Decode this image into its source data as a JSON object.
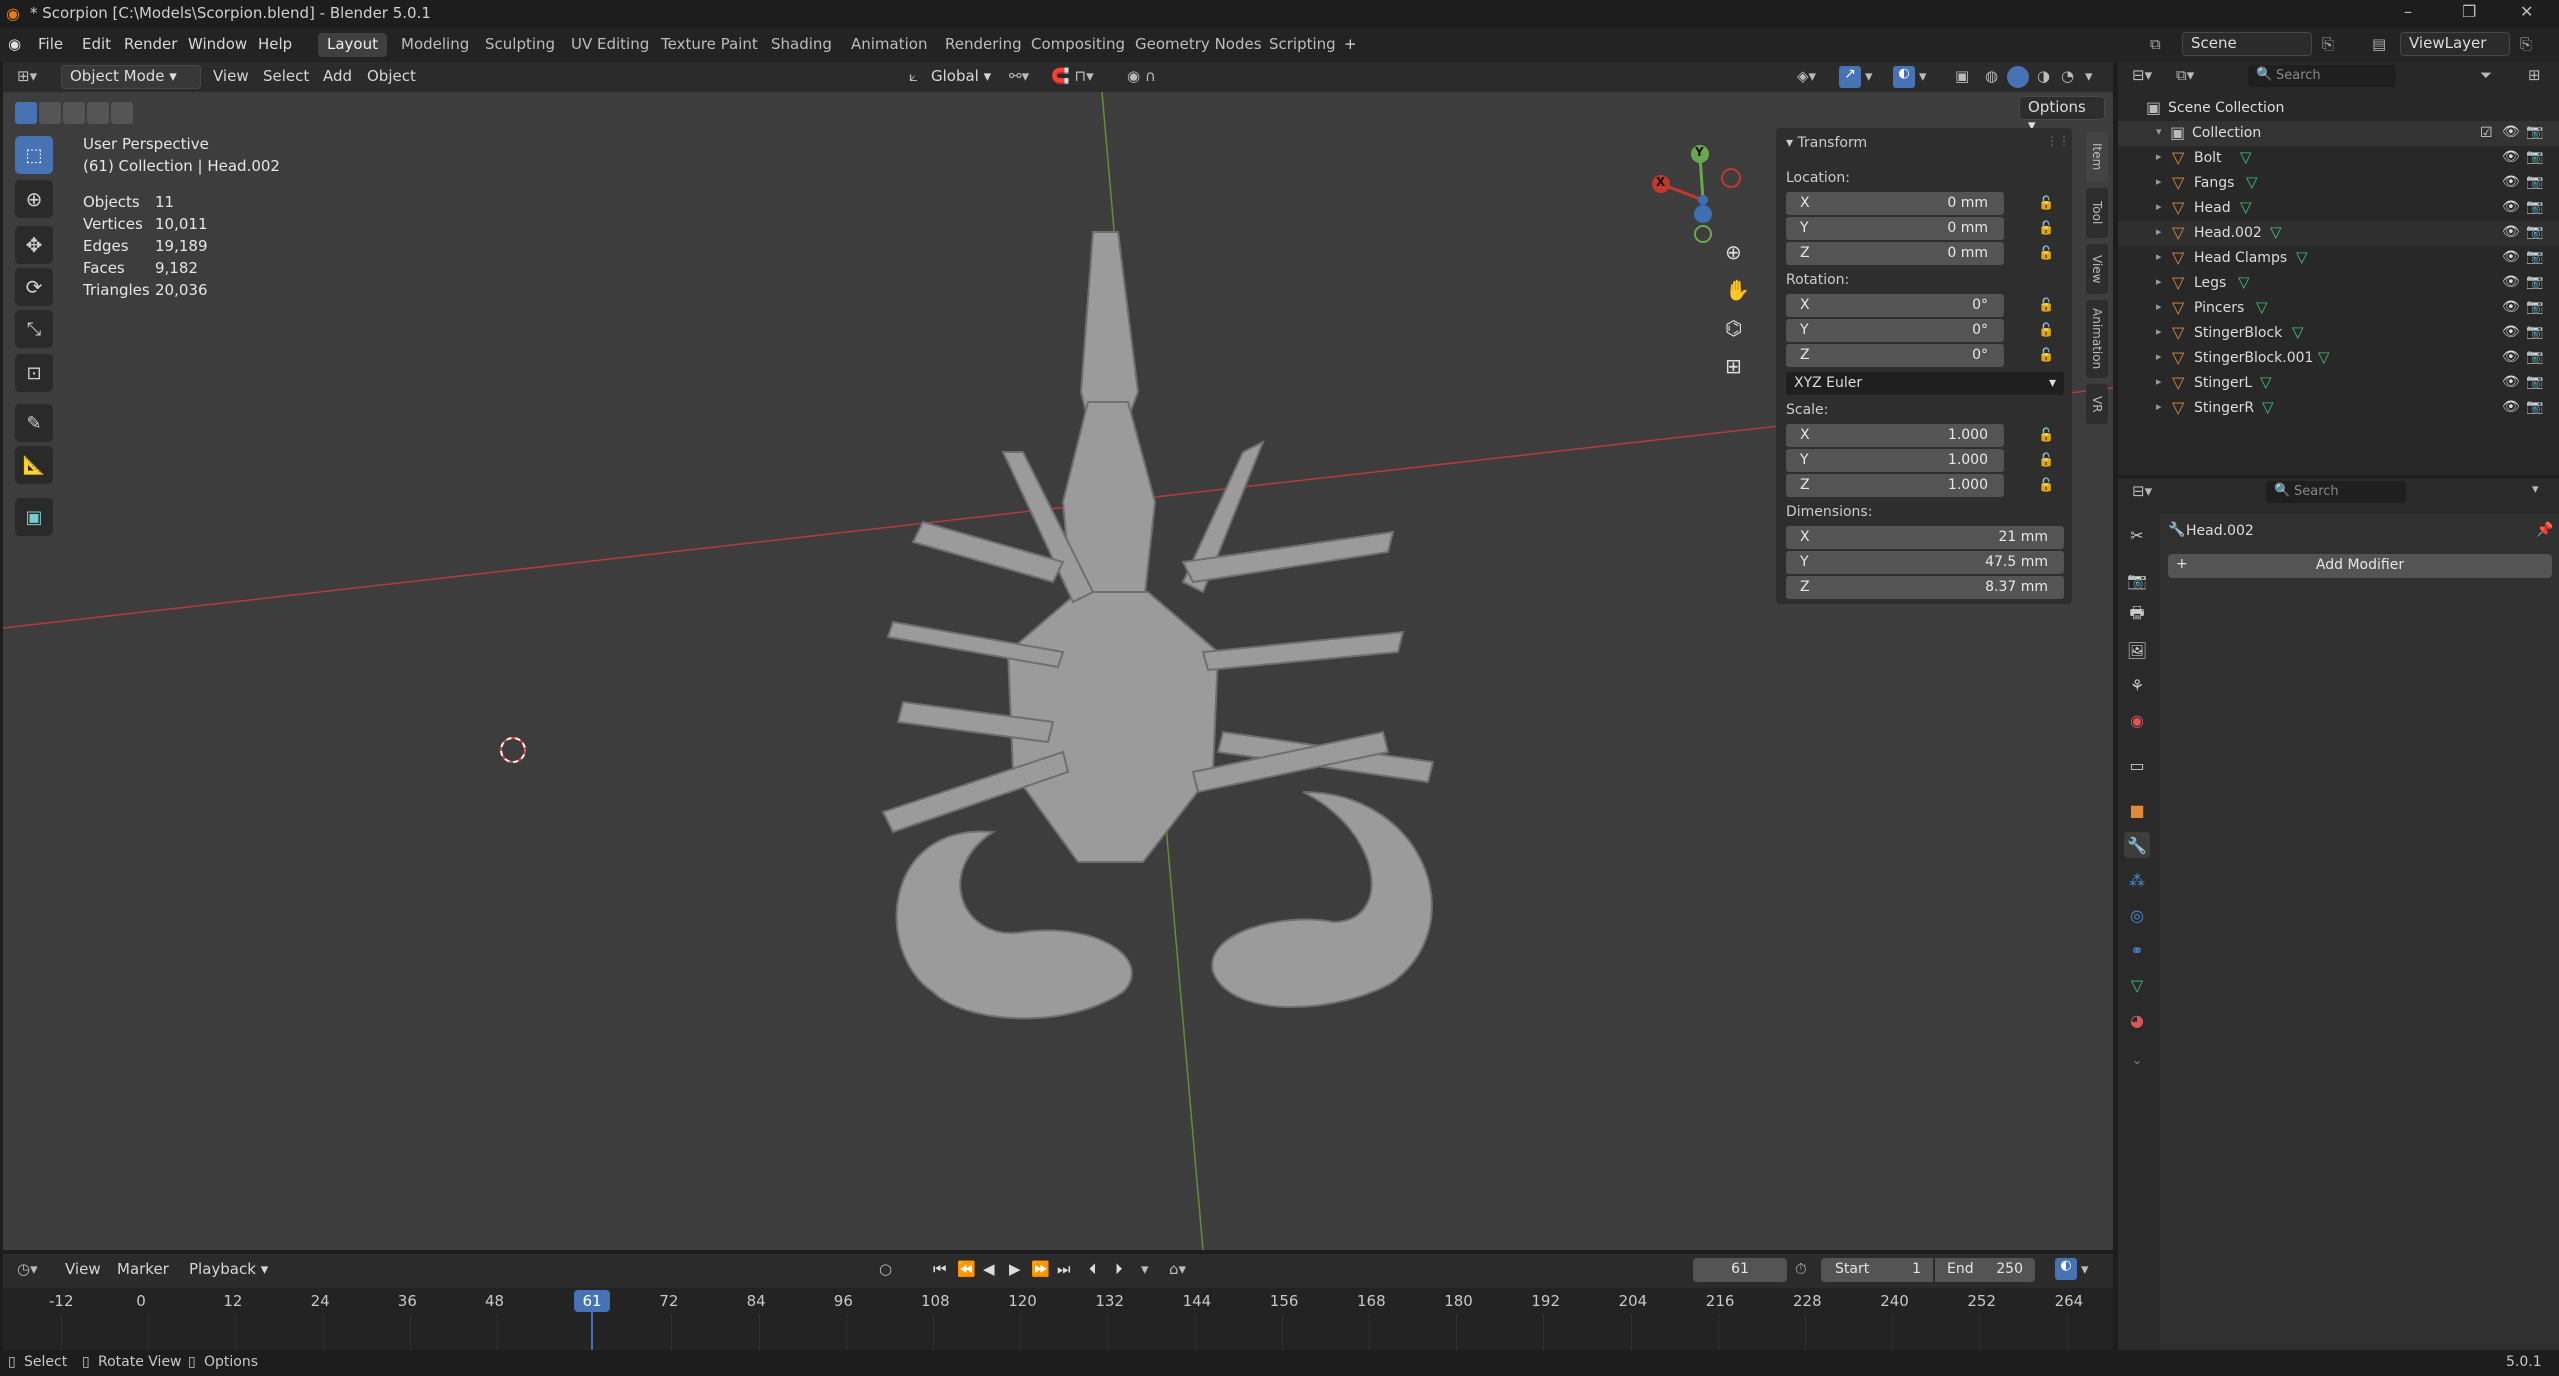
{
  "window": {
    "title": "* Scorpion [C:\\Models\\Scorpion.blend] - Blender 5.0.1"
  },
  "menu": {
    "file": "File",
    "edit": "Edit",
    "render": "Render",
    "window": "Window",
    "help": "Help"
  },
  "workspaces": [
    "Layout",
    "Modeling",
    "Sculpting",
    "UV Editing",
    "Texture Paint",
    "Shading",
    "Animation",
    "Rendering",
    "Compositing",
    "Geometry Nodes",
    "Scripting"
  ],
  "scene": {
    "label": "Scene",
    "viewlayer": "ViewLayer"
  },
  "viewport_header": {
    "mode": "Object Mode",
    "view": "View",
    "select": "Select",
    "add": "Add",
    "object": "Object",
    "orientation": "Global",
    "options": "Options"
  },
  "overlay": {
    "perspective": "User Perspective",
    "collection_line": "(61) Collection | Head.002"
  },
  "stats": {
    "objects_label": "Objects",
    "objects": "11",
    "vertices_label": "Vertices",
    "vertices": "10,011",
    "edges_label": "Edges",
    "edges": "19,189",
    "faces_label": "Faces",
    "faces": "9,182",
    "triangles_label": "Triangles",
    "triangles": "20,036"
  },
  "gizmo": {
    "x": "X",
    "y": "Y"
  },
  "npanel": {
    "header": "Transform",
    "location_label": "Location:",
    "loc": [
      {
        "axis": "X",
        "value": "0 mm"
      },
      {
        "axis": "Y",
        "value": "0 mm"
      },
      {
        "axis": "Z",
        "value": "0 mm"
      }
    ],
    "rotation_label": "Rotation:",
    "rot": [
      {
        "axis": "X",
        "value": "0°"
      },
      {
        "axis": "Y",
        "value": "0°"
      },
      {
        "axis": "Z",
        "value": "0°"
      }
    ],
    "rotation_mode": "XYZ Euler",
    "scale_label": "Scale:",
    "scale": [
      {
        "axis": "X",
        "value": "1.000"
      },
      {
        "axis": "Y",
        "value": "1.000"
      },
      {
        "axis": "Z",
        "value": "1.000"
      }
    ],
    "dimensions_label": "Dimensions:",
    "dim": [
      {
        "axis": "X",
        "value": "21 mm"
      },
      {
        "axis": "Y",
        "value": "47.5 mm"
      },
      {
        "axis": "Z",
        "value": "8.37 mm"
      }
    ],
    "tabs": [
      "Item",
      "Tool",
      "View",
      "Animation",
      "VR"
    ]
  },
  "outliner": {
    "search_placeholder": "Search",
    "scene_collection": "Scene Collection",
    "collection": "Collection",
    "objects": [
      "Bolt",
      "Fangs",
      "Head",
      "Head.002",
      "Head Clamps",
      "Legs",
      "Pincers",
      "StingerBlock",
      "StingerBlock.001",
      "StingerL",
      "StingerR"
    ]
  },
  "properties": {
    "search_placeholder": "Search",
    "object_name": "Head.002",
    "add_modifier": "Add Modifier"
  },
  "timeline": {
    "view": "View",
    "marker": "Marker",
    "playback": "Playback",
    "current_frame": "61",
    "start_label": "Start",
    "start": "1",
    "end_label": "End",
    "end": "250",
    "ticks": [
      "-12",
      "0",
      "12",
      "24",
      "36",
      "48",
      "61",
      "72",
      "84",
      "96",
      "108",
      "120",
      "132",
      "144",
      "156",
      "168",
      "180",
      "192",
      "204",
      "216",
      "228",
      "240",
      "252",
      "264"
    ]
  },
  "statusbar": {
    "select": "Select",
    "rotate": "Rotate View",
    "options": "Options",
    "version": "5.0.1"
  },
  "colors": {
    "accent": "#4772b3",
    "mesh": "#e08a3a",
    "vgroup": "#45c07a",
    "x_axis": "#c0392b",
    "y_axis": "#6aa84f"
  }
}
